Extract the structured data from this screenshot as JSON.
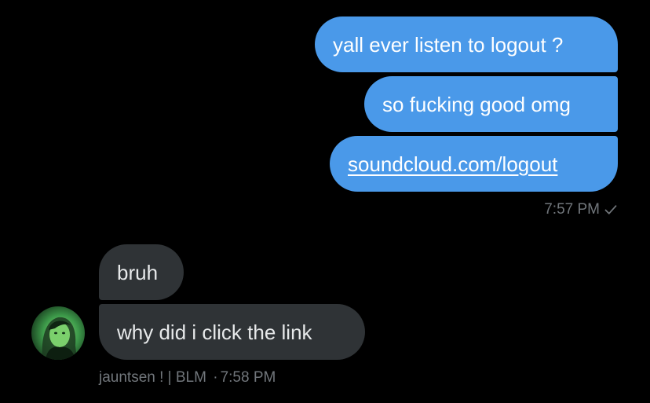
{
  "conversation": {
    "sent_messages": [
      {
        "text": "yall ever listen to logout ?"
      },
      {
        "text": "so fucking good omg"
      },
      {
        "link_text": "soundcloud.com/logout"
      }
    ],
    "sent_timestamp": "7:57 PM",
    "sent_status_icon": "checkmark-icon",
    "received_messages": [
      {
        "text": "bruh"
      },
      {
        "text": "why did i click the link"
      }
    ],
    "sender_name": "jauntsen ! | BLM",
    "received_timestamp": "7:58 PM",
    "separator": "·"
  },
  "colors": {
    "background": "#000000",
    "sent_bubble": "#4a99e9",
    "received_bubble": "#2f3336",
    "meta_text": "#71767b"
  }
}
